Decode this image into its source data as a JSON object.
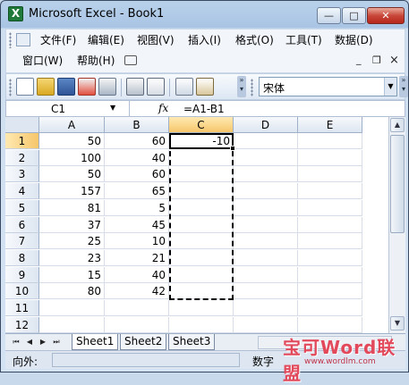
{
  "window": {
    "title": "Microsoft Excel - Book1",
    "minimize": "—",
    "maximize": "□",
    "close": "✕"
  },
  "menu": {
    "items": [
      "文件(F)",
      "编辑(E)",
      "视图(V)",
      "插入(I)",
      "格式(O)",
      "工具(T)",
      "数据(D)"
    ],
    "row2": [
      "窗口(W)",
      "帮助(H)"
    ],
    "mdi": {
      "minimize": "_",
      "restore": "❐",
      "close": "×"
    }
  },
  "toolbar": {
    "icons": [
      "new-icon",
      "open-icon",
      "save-icon",
      "permission-icon",
      "email-icon",
      "print-icon",
      "print-preview-icon",
      "spelling-icon",
      "research-icon"
    ],
    "font_name": "宋体"
  },
  "formula_bar": {
    "name_box": "C1",
    "fx": "fx",
    "formula": "=A1-B1"
  },
  "grid": {
    "columns": [
      "A",
      "B",
      "C",
      "D",
      "E"
    ],
    "rows": [
      "1",
      "2",
      "3",
      "4",
      "5",
      "6",
      "7",
      "8",
      "9",
      "10",
      "11",
      "12"
    ],
    "values_a": [
      "50",
      "100",
      "50",
      "157",
      "81",
      "37",
      "25",
      "23",
      "15",
      "80",
      "",
      ""
    ],
    "values_b": [
      "60",
      "40",
      "60",
      "65",
      "5",
      "45",
      "10",
      "21",
      "40",
      "42",
      "",
      ""
    ],
    "values_c": [
      "-10",
      "",
      "",
      "",
      "",
      "",
      "",
      "",
      "",
      "",
      "",
      ""
    ],
    "active_cell": "C1"
  },
  "sheets": {
    "tabs": [
      "Sheet1",
      "Sheet2",
      "Sheet3"
    ],
    "active": "Sheet1",
    "nav": [
      "⏮",
      "◀",
      "▶",
      "⏭"
    ]
  },
  "status": {
    "left": "向外:",
    "mode": "数字"
  },
  "watermark": {
    "text": "宝可Word联盟",
    "url": "www.wordlm.com"
  },
  "colors": {
    "title_gradient": "#b9d1ea",
    "close_red": "#c8473a",
    "active_header": "#f6c66a",
    "watermark": "#e24a5c"
  }
}
